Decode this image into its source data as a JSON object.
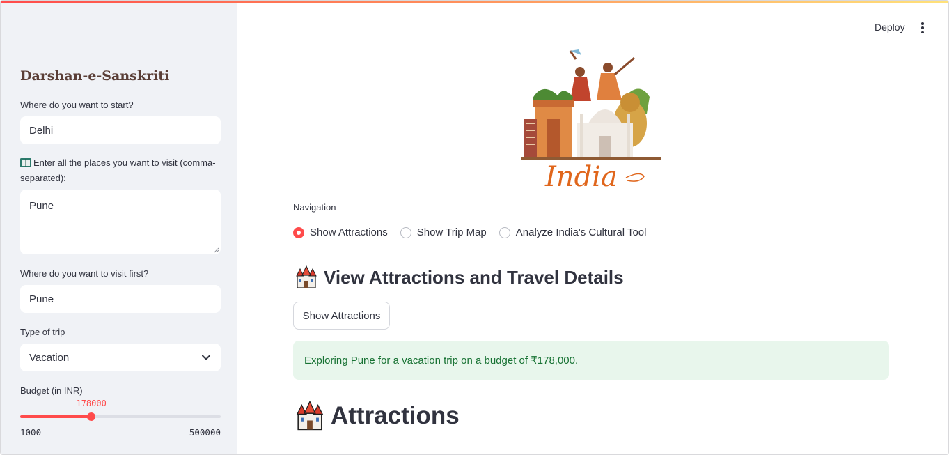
{
  "header": {
    "deploy_label": "Deploy",
    "menu_icon": "kebab-menu-icon"
  },
  "sidebar": {
    "app_title": "Darshan-e-Sanskriti",
    "start": {
      "label": "Where do you want to start?",
      "value": "Delhi"
    },
    "places": {
      "icon": "open-book-icon",
      "label": "Enter all the places you want to visit (comma-separated):",
      "value": "Pune"
    },
    "first": {
      "label": "Where do you want to visit first?",
      "value": "Pune"
    },
    "trip_type": {
      "label": "Type of trip",
      "value": "Vacation"
    },
    "budget": {
      "label": "Budget (in INR)",
      "value": 178000,
      "value_text": "178000",
      "min": 1000,
      "max": 500000,
      "min_text": "1000",
      "max_text": "500000"
    }
  },
  "main": {
    "hero": {
      "caption": "India",
      "image_icon": "india-culture-illustration"
    },
    "navigation": {
      "label": "Navigation",
      "options": [
        "Show Attractions",
        "Show Trip Map",
        "Analyze India's Cultural Tool"
      ],
      "selected_index": 0
    },
    "section_heading": "View Attractions and Travel Details",
    "show_button_label": "Show Attractions",
    "alert_text": "Exploring Pune for a vacation trip on a budget of ₹178,000.",
    "attractions_heading": "Attractions",
    "heading_icon": "castle-icon",
    "colors": {
      "accent": "#ff4b4b",
      "success_bg": "#e8f6ec",
      "success_text": "#177233",
      "sidebar_bg": "#f0f2f6"
    }
  }
}
